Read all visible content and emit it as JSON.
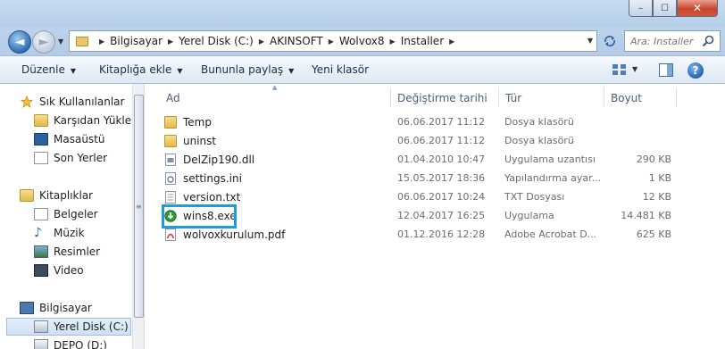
{
  "window": {
    "controls": {
      "minimize": "–",
      "maximize": "☐",
      "close": "✕"
    }
  },
  "nav": {
    "back_glyph": "◄",
    "forward_glyph": "►",
    "breadcrumb": [
      "Bilgisayar",
      "Yerel Disk (C:)",
      "AKINSOFT",
      "Wolvox8",
      "Installer"
    ],
    "search_placeholder": "Ara: Installer"
  },
  "toolbar": {
    "organize": "Düzenle",
    "add_to_library": "Kitaplığa ekle",
    "share_with": "Bununla paylaş",
    "new_folder": "Yeni klasör",
    "help": "?"
  },
  "sidebar": {
    "favorites_header": "Sık Kullanılanlar",
    "favorites": [
      "Karşıdan Yükleme",
      "Masaüstü",
      "Son Yerler"
    ],
    "libraries_header": "Kitaplıklar",
    "libraries": [
      "Belgeler",
      "Müzik",
      "Resimler",
      "Video"
    ],
    "computer_header": "Bilgisayar",
    "drives": [
      "Yerel Disk (C:)",
      "DEPO (D:)"
    ],
    "selected": "Yerel Disk (C:)"
  },
  "columns": {
    "name": "Ad",
    "date": "Değiştirme tarihi",
    "type": "Tür",
    "size": "Boyut"
  },
  "files": [
    {
      "name": "Temp",
      "date": "06.06.2017 11:12",
      "type": "Dosya klasörü",
      "size": "",
      "icon": "folder-icon"
    },
    {
      "name": "uninst",
      "date": "06.06.2017 11:12",
      "type": "Dosya klasörü",
      "size": "",
      "icon": "folder-icon"
    },
    {
      "name": "DelZip190.dll",
      "date": "01.04.2010 10:47",
      "type": "Uygulama uzantısı",
      "size": "290 KB",
      "icon": "dll-file-icon"
    },
    {
      "name": "settings.ini",
      "date": "15.05.2017 18:36",
      "type": "Yapılandırma ayar...",
      "size": "1 KB",
      "icon": "ini-file-icon"
    },
    {
      "name": "version.txt",
      "date": "06.06.2017 10:24",
      "type": "TXT Dosyası",
      "size": "12 KB",
      "icon": "text-file-icon"
    },
    {
      "name": "wins8.exe",
      "date": "12.04.2017 16:25",
      "type": "Uygulama",
      "size": "14.481 KB",
      "icon": "installer-exe-icon"
    },
    {
      "name": "wolvoxkurulum.pdf",
      "date": "01.12.2016 12:28",
      "type": "Adobe Acrobat D...",
      "size": "625 KB",
      "icon": "pdf-file-icon"
    }
  ],
  "highlighted_file": "wins8.exe",
  "colors": {
    "highlight_box": "#1f9ae0",
    "selection": "#cfe1f5"
  }
}
